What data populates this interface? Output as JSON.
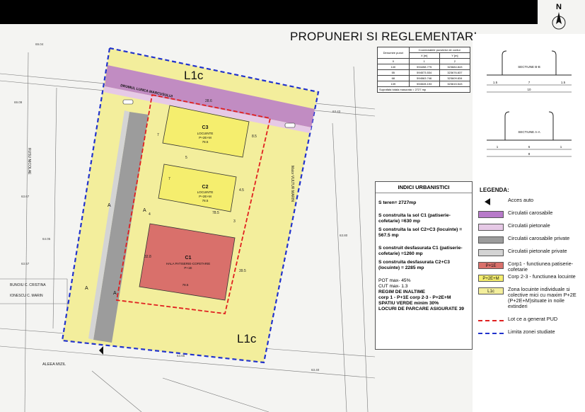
{
  "header": {
    "title": "PROPUNERI SI REGLEMENTARI",
    "north": "N"
  },
  "map": {
    "zone_label_top": "L1c",
    "zone_label_bottom": "L1c",
    "road_label": "DRUMUL LUNCA MARCUSULUI",
    "street_label_east": "Maior VULTUR MARIN",
    "street_label_west": "RUSU NICOLAE",
    "street_label_south": "ALEEA MIZIL",
    "owner_1": "BUNOIU C. CRISTINA",
    "owner_2": "IONESCU C. MARIN",
    "buildings": [
      {
        "id": "C3",
        "use": "LOCUINTE",
        "height": "P+2E+M",
        "area": "78.5"
      },
      {
        "id": "C2",
        "use": "LOCUINTE",
        "height": "P+2E+M",
        "area": "78.5"
      },
      {
        "id": "C1",
        "use": "HALA PATISERIE-COFETARIE",
        "height": "P+1E",
        "area": "78.5"
      }
    ],
    "dims": [
      "28.6",
      "7",
      "7",
      "5",
      "8.5",
      "4.5",
      "4",
      "3",
      "78.5",
      "32.8",
      "39.5"
    ],
    "points": [
      "A",
      "A",
      "A",
      "A"
    ]
  },
  "sections": {
    "b_title": "SECTIUNE B-B",
    "a_title": "SECTIUNE A-A",
    "b_dims": [
      "1.5",
      "7",
      "1.5",
      "10"
    ],
    "a_dims": [
      "1",
      "6",
      "1",
      "8"
    ]
  },
  "coord_table": {
    "headers": [
      "Denumire punct",
      "Coordonatele punctelor de contur",
      "X [m]",
      "Y [m]"
    ],
    "index_row": [
      "0",
      "1",
      "2"
    ],
    "rows": [
      [
        "140",
        "594458.775",
        "323684.843"
      ],
      [
        "55",
        "594573.534",
        "323676.837"
      ],
      [
        "68",
        "594563.746",
        "323609.834"
      ],
      [
        "139",
        "594528.193",
        "323615.543"
      ]
    ],
    "note": "Suprafata totala masurata = 2727 mp"
  },
  "indici": {
    "title": "INDICI URBANISTICI",
    "lines": [
      "S teren= 2727mp",
      "S construita la sol C1 (patiserie-cofetarie) =630 mp",
      "S construita la sol C2+C3 (locuinte) = 567.5 mp",
      "S construit desfasurata C1 (patiserie-cofetarie) =1260 mp",
      "S construita desfasurata C2+C3 (locuinte) = 2285 mp",
      "POT max- 45%",
      "CUT max- 1.3",
      "REGIM DE INALTIME",
      "corp 1 - P+1E    corp 2-3 - P+2E+M",
      "SPATIU VERDE minim 30%",
      "LOCURI DE PARCARE ASIGURATE 39"
    ]
  },
  "legend": {
    "title": "LEGENDA:",
    "items": [
      {
        "label": "Acces auto",
        "swatch": ""
      },
      {
        "label": "Circulatii carosabile",
        "swatch": "",
        "color": "#b77ac9"
      },
      {
        "label": "Circulatii pietonale",
        "swatch": "",
        "color": "#e6c9e6"
      },
      {
        "label": "Circulatii carosabile private",
        "swatch": "",
        "color": "#9c9c9c"
      },
      {
        "label": "Circulatii pietonale private",
        "swatch": "",
        "color": "#d4d4d4"
      },
      {
        "label": "Corp1 - functiunea patiserie-cofetarie",
        "swatch": "P+1E",
        "color": "#d9706b"
      },
      {
        "label": "Corp 2-3 - functiunea locuinte",
        "swatch": "P+2E+M",
        "color": "#f5ee6e"
      },
      {
        "label": "Zona locuinte individuale si colective mici cu maxim P+2E (P+2E+M)situate in noile extinderi",
        "swatch": "L1c",
        "color": "#f3ee9c"
      },
      {
        "label": "Lot ce a generat PUD",
        "swatch": "",
        "color": "#e02020"
      },
      {
        "label": "Limita zonei studiate",
        "swatch": "",
        "color": "#2233cc"
      }
    ]
  }
}
